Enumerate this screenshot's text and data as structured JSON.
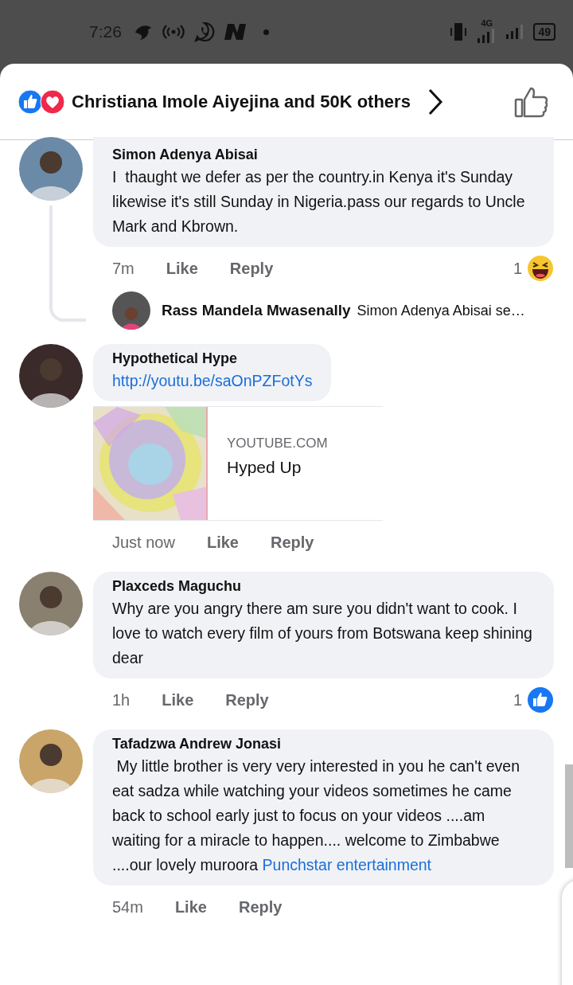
{
  "status_bar": {
    "time": "7:26",
    "network": "4G",
    "battery": "49"
  },
  "header": {
    "reactors": "Christiana Imole Aiyejina and 50K others"
  },
  "comments": [
    {
      "author": "Simon Adenya Abisai",
      "text": "I  thaught we defer as per the country.in Kenya it's Sunday likewise it's still Sunday in Nigeria.pass our regards to Uncle Mark and Kbrown.",
      "time": "7m",
      "like": "Like",
      "reply": "Reply",
      "reaction": {
        "count": "1",
        "kind": "haha"
      },
      "reply_preview": {
        "author": "Rass Mandela Mwasenally",
        "text": "Simon Adenya Abisai se…"
      }
    },
    {
      "author": "Hypothetical Hype",
      "link": "http://youtu.be/saOnPZFotYs",
      "link_preview": {
        "site": "YOUTUBE.COM",
        "title": "Hyped Up"
      },
      "time": "Just now",
      "like": "Like",
      "reply": "Reply"
    },
    {
      "author": "Plaxceds Maguchu",
      "text": "Why are you angry there am sure you didn't want to cook. I love to watch every film of yours from Botswana keep shining dear",
      "time": "1h",
      "like": "Like",
      "reply": "Reply",
      "reaction": {
        "count": "1",
        "kind": "like"
      }
    },
    {
      "author": "Tafadzwa Andrew Jonasi",
      "text": " My little brother is very very interested in you he can't even eat sadza while watching your videos sometimes he came back to school early just to focus on your videos ....am waiting for a miracle to happen.... welcome to Zimbabwe      ....our lovely muroora",
      "mention": "Punchstar entertainment",
      "time": "54m",
      "like": "Like",
      "reply": "Reply"
    }
  ]
}
